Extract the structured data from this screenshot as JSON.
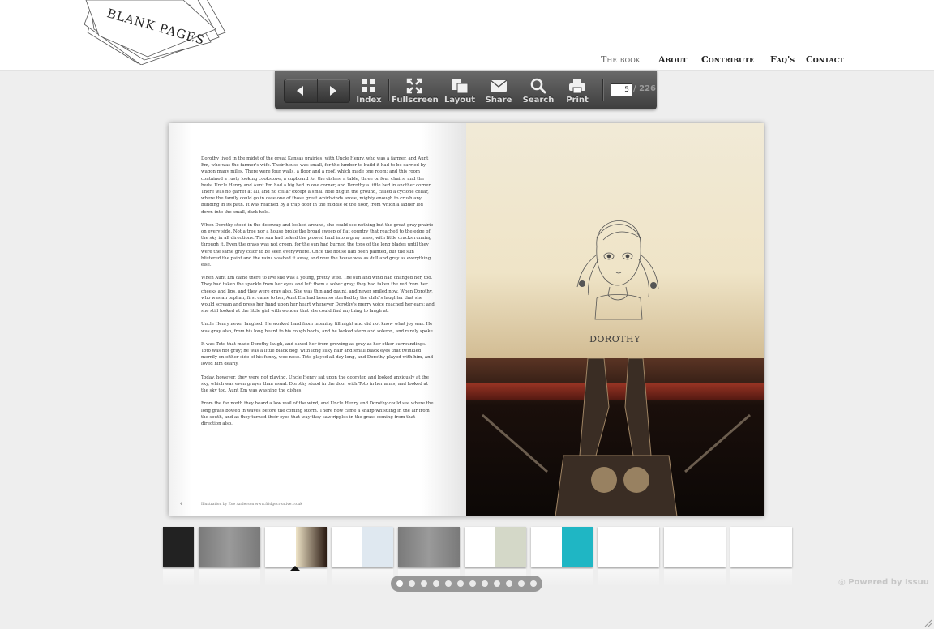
{
  "site": {
    "logo_text": "BLANK PAGES"
  },
  "nav": {
    "items": [
      {
        "label": "The book",
        "active": true
      },
      {
        "label": "About",
        "active": false
      },
      {
        "label": "Contribute",
        "active": false
      },
      {
        "label": "Faq's",
        "active": false
      },
      {
        "label": "Contact",
        "active": false
      }
    ]
  },
  "toolbar": {
    "prev_icon": "triangle-left-icon",
    "next_icon": "triangle-right-icon",
    "tools": [
      {
        "label": "Index",
        "icon": "grid-icon"
      },
      {
        "label": "Fullscreen",
        "icon": "expand-icon"
      },
      {
        "label": "Layout",
        "icon": "layout-icon"
      },
      {
        "label": "Share",
        "icon": "envelope-icon"
      },
      {
        "label": "Search",
        "icon": "magnifier-icon"
      },
      {
        "label": "Print",
        "icon": "printer-icon"
      }
    ],
    "current_page": "5",
    "total_pages": "/ 226"
  },
  "book": {
    "left_paragraphs": [
      "Dorothy lived in the midst of the great Kansas prairies, with Uncle Henry, who was a farmer, and Aunt Em, who was the farmer's wife. Their house was small, for the lumber to build it had to be carried by wagon many miles. There were four walls, a floor and a roof, which made one room; and this room contained a rusty looking cookstove, a cupboard for the dishes, a table, three or four chairs, and the beds. Uncle Henry and Aunt Em had a big bed in one corner, and Dorothy a little bed in another corner. There was no garret at all, and no cellar except a small hole dug in the ground, called a cyclone cellar, where the family could go in case one of those great whirlwinds arose, mighty enough to crush any building in its path. It was reached by a trap door in the middle of the floor, from which a ladder led down into the small, dark hole.",
      "When Dorothy stood in the doorway and looked around, she could see nothing but the great gray prairie on every side. Not a tree nor a house broke the broad sweep of flat country that reached to the edge of the sky in all directions. The sun had baked the plowed land into a gray mass, with little cracks running through it. Even the grass was not green, for the sun had burned the tops of the long blades until they were the same gray color to be seen everywhere. Once the house had been painted, but the sun blistered the paint and the rains washed it away, and now the house was as dull and gray as everything else.",
      "When Aunt Em came there to live she was a young, pretty wife. The sun and wind had changed her, too. They had taken the sparkle from her eyes and left them a sober gray; they had taken the red from her cheeks and lips, and they were gray also. She was thin and gaunt, and never smiled now. When Dorothy, who was an orphan, first came to her, Aunt Em had been so startled by the child's laughter that she would scream and press her hand upon her heart whenever Dorothy's merry voice reached her ears; and she still looked at the little girl with wonder that she could find anything to laugh at.",
      "Uncle Henry never laughed. He worked hard from morning till night and did not know what joy was. He was gray also, from his long beard to his rough boots, and he looked stern and solemn, and rarely spoke.",
      "It was Toto that made Dorothy laugh, and saved her from growing as gray as her other surroundings. Toto was not gray; he was a little black dog, with long silky hair and small black eyes that twinkled merrily on either side of his funny, wee nose. Toto played all day long, and Dorothy played with him, and loved him dearly.",
      "Today, however, they were not playing. Uncle Henry sat upon the doorstep and looked anxiously at the sky, which was even grayer than usual. Dorothy stood in the door with Toto in her arms, and looked at the sky too. Aunt Em was washing the dishes.",
      "From the far north they heard a low wail of the wind, and Uncle Henry and Dorothy could see where the long grass bowed in waves before the coming storm. There now came a sharp whistling in the air from the south, and as they turned their eyes that way they saw ripples in the grass coming from that direction also."
    ],
    "left_folio": "4",
    "left_credit": "Illustration by Zoe Anderson   www.fridgecreative.co.uk",
    "right_caption": "DOROTHY"
  },
  "thumbnails": {
    "count": 12,
    "dots": 12,
    "active_dot": 0
  },
  "footer": {
    "powered_by": "Powered by Issuu"
  }
}
